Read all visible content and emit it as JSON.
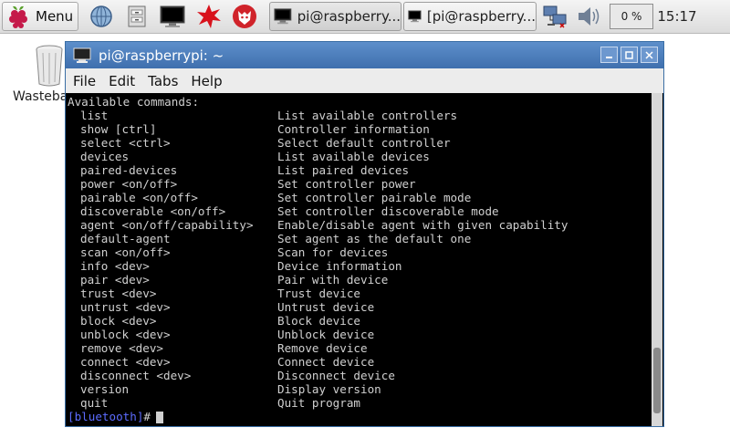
{
  "taskbar": {
    "menu_label": "Menu",
    "tasks": [
      {
        "label": "pi@raspberry..."
      },
      {
        "label": "[pi@raspberry..."
      }
    ],
    "cpu_usage": "0 %",
    "clock": "15:17"
  },
  "desktop": {
    "wastebasket_label": "Wasteba"
  },
  "window": {
    "title": "pi@raspberrypi: ~",
    "menu": [
      "File",
      "Edit",
      "Tabs",
      "Help"
    ]
  },
  "terminal": {
    "header": "Available commands:",
    "commands": [
      {
        "cmd": "list",
        "desc": "List available controllers"
      },
      {
        "cmd": "show [ctrl]",
        "desc": "Controller information"
      },
      {
        "cmd": "select <ctrl>",
        "desc": "Select default controller"
      },
      {
        "cmd": "devices",
        "desc": "List available devices"
      },
      {
        "cmd": "paired-devices",
        "desc": "List paired devices"
      },
      {
        "cmd": "power <on/off>",
        "desc": "Set controller power"
      },
      {
        "cmd": "pairable <on/off>",
        "desc": "Set controller pairable mode"
      },
      {
        "cmd": "discoverable <on/off>",
        "desc": "Set controller discoverable mode"
      },
      {
        "cmd": "agent <on/off/capability>",
        "desc": "Enable/disable agent with given capability"
      },
      {
        "cmd": "default-agent",
        "desc": "Set agent as the default one"
      },
      {
        "cmd": "scan <on/off>",
        "desc": "Scan for devices"
      },
      {
        "cmd": "info <dev>",
        "desc": "Device information"
      },
      {
        "cmd": "pair <dev>",
        "desc": "Pair with device"
      },
      {
        "cmd": "trust <dev>",
        "desc": "Trust device"
      },
      {
        "cmd": "untrust <dev>",
        "desc": "Untrust device"
      },
      {
        "cmd": "block <dev>",
        "desc": "Block device"
      },
      {
        "cmd": "unblock <dev>",
        "desc": "Unblock device"
      },
      {
        "cmd": "remove <dev>",
        "desc": "Remove device"
      },
      {
        "cmd": "connect <dev>",
        "desc": "Connect device"
      },
      {
        "cmd": "disconnect <dev>",
        "desc": "Disconnect device"
      },
      {
        "cmd": "version",
        "desc": "Display version"
      },
      {
        "cmd": "quit",
        "desc": "Quit program"
      }
    ],
    "prompt": "[bluetooth]",
    "prompt_symbol": "#",
    "scroll_position": 0.96
  },
  "icons": {
    "menu": "raspberry-icon",
    "launchers": [
      "browser-globe-icon",
      "file-manager-icon",
      "terminal-icon",
      "math-kernel-icon",
      "wolfram-icon"
    ],
    "task_icons": [
      "terminal-icon",
      "terminal-icon"
    ],
    "tray": [
      "network-icon",
      "volume-icon"
    ],
    "desktop": "wastebasket-icon",
    "window": "terminal-icon",
    "window_controls": [
      "minimize-icon",
      "maximize-icon",
      "close-icon"
    ]
  }
}
